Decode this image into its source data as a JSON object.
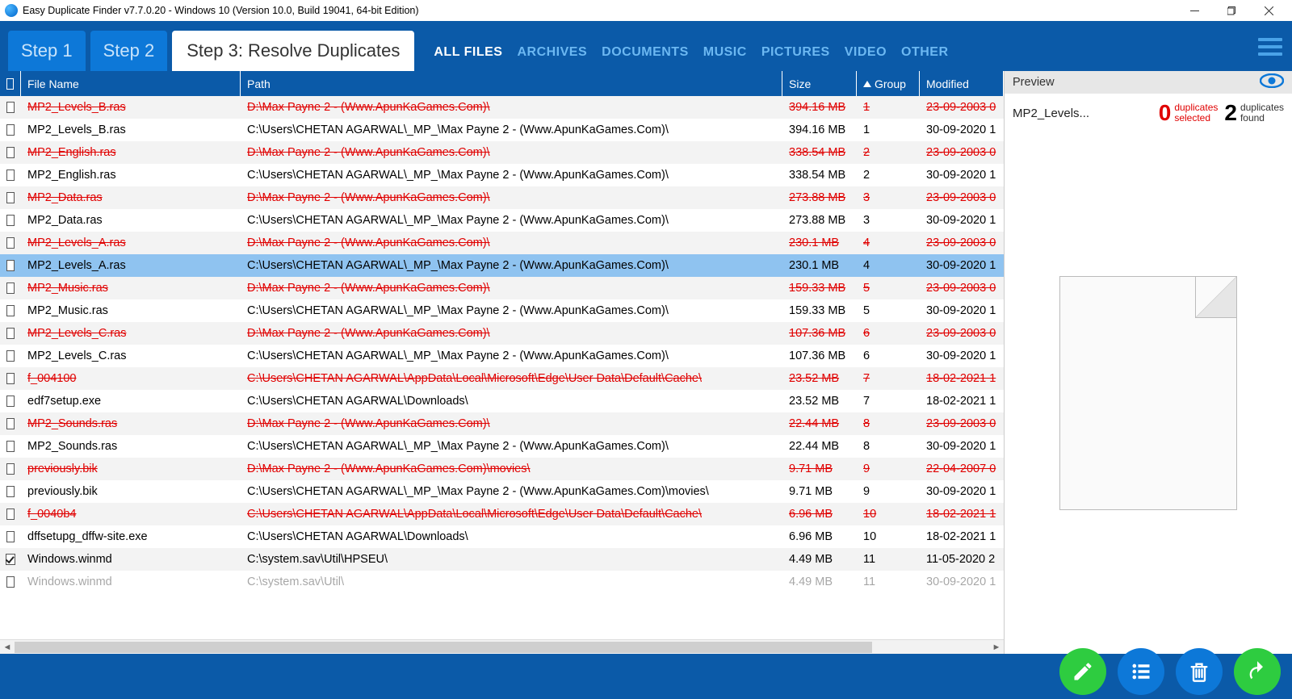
{
  "window": {
    "title": "Easy Duplicate Finder v7.7.0.20 - Windows 10 (Version 10.0, Build 19041, 64-bit Edition)"
  },
  "steps": {
    "step1": "Step 1",
    "step2": "Step 2",
    "step3": "Step 3: Resolve Duplicates"
  },
  "filters": {
    "all": "ALL FILES",
    "archives": "ARCHIVES",
    "documents": "DOCUMENTS",
    "music": "MUSIC",
    "pictures": "PICTURES",
    "video": "VIDEO",
    "other": "OTHER"
  },
  "columns": {
    "name": "File Name",
    "path": "Path",
    "size": "Size",
    "group": "Group",
    "modified": "Modified"
  },
  "rows": [
    {
      "struck": true,
      "name": "MP2_Levels_B.ras",
      "path": "D:\\Max Payne 2 - (Www.ApunKaGames.Com)\\",
      "size": "394.16 MB",
      "group": "1",
      "modified": "23-09-2003 0"
    },
    {
      "struck": false,
      "name": "MP2_Levels_B.ras",
      "path": "C:\\Users\\CHETAN AGARWAL\\_MP_\\Max Payne 2 - (Www.ApunKaGames.Com)\\",
      "size": "394.16 MB",
      "group": "1",
      "modified": "30-09-2020 1"
    },
    {
      "struck": true,
      "name": "MP2_English.ras",
      "path": "D:\\Max Payne 2 - (Www.ApunKaGames.Com)\\",
      "size": "338.54 MB",
      "group": "2",
      "modified": "23-09-2003 0"
    },
    {
      "struck": false,
      "name": "MP2_English.ras",
      "path": "C:\\Users\\CHETAN AGARWAL\\_MP_\\Max Payne 2 - (Www.ApunKaGames.Com)\\",
      "size": "338.54 MB",
      "group": "2",
      "modified": "30-09-2020 1"
    },
    {
      "struck": true,
      "name": "MP2_Data.ras",
      "path": "D:\\Max Payne 2 - (Www.ApunKaGames.Com)\\",
      "size": "273.88 MB",
      "group": "3",
      "modified": "23-09-2003 0"
    },
    {
      "struck": false,
      "name": "MP2_Data.ras",
      "path": "C:\\Users\\CHETAN AGARWAL\\_MP_\\Max Payne 2 - (Www.ApunKaGames.Com)\\",
      "size": "273.88 MB",
      "group": "3",
      "modified": "30-09-2020 1"
    },
    {
      "struck": true,
      "name": "MP2_Levels_A.ras",
      "path": "D:\\Max Payne 2 - (Www.ApunKaGames.Com)\\",
      "size": "230.1 MB",
      "group": "4",
      "modified": "23-09-2003 0"
    },
    {
      "struck": false,
      "selected": true,
      "name": "MP2_Levels_A.ras",
      "path": "C:\\Users\\CHETAN AGARWAL\\_MP_\\Max Payne 2 - (Www.ApunKaGames.Com)\\",
      "size": "230.1 MB",
      "group": "4",
      "modified": "30-09-2020 1"
    },
    {
      "struck": true,
      "name": "MP2_Music.ras",
      "path": "D:\\Max Payne 2 - (Www.ApunKaGames.Com)\\",
      "size": "159.33 MB",
      "group": "5",
      "modified": "23-09-2003 0"
    },
    {
      "struck": false,
      "name": "MP2_Music.ras",
      "path": "C:\\Users\\CHETAN AGARWAL\\_MP_\\Max Payne 2 - (Www.ApunKaGames.Com)\\",
      "size": "159.33 MB",
      "group": "5",
      "modified": "30-09-2020 1"
    },
    {
      "struck": true,
      "name": "MP2_Levels_C.ras",
      "path": "D:\\Max Payne 2 - (Www.ApunKaGames.Com)\\",
      "size": "107.36 MB",
      "group": "6",
      "modified": "23-09-2003 0"
    },
    {
      "struck": false,
      "name": "MP2_Levels_C.ras",
      "path": "C:\\Users\\CHETAN AGARWAL\\_MP_\\Max Payne 2 - (Www.ApunKaGames.Com)\\",
      "size": "107.36 MB",
      "group": "6",
      "modified": "30-09-2020 1"
    },
    {
      "struck": true,
      "name": "f_004100",
      "path": "C:\\Users\\CHETAN AGARWAL\\AppData\\Local\\Microsoft\\Edge\\User Data\\Default\\Cache\\",
      "size": "23.52 MB",
      "group": "7",
      "modified": "18-02-2021 1"
    },
    {
      "struck": false,
      "name": "edf7setup.exe",
      "path": "C:\\Users\\CHETAN AGARWAL\\Downloads\\",
      "size": "23.52 MB",
      "group": "7",
      "modified": "18-02-2021 1"
    },
    {
      "struck": true,
      "name": "MP2_Sounds.ras",
      "path": "D:\\Max Payne 2 - (Www.ApunKaGames.Com)\\",
      "size": "22.44 MB",
      "group": "8",
      "modified": "23-09-2003 0"
    },
    {
      "struck": false,
      "name": "MP2_Sounds.ras",
      "path": "C:\\Users\\CHETAN AGARWAL\\_MP_\\Max Payne 2 - (Www.ApunKaGames.Com)\\",
      "size": "22.44 MB",
      "group": "8",
      "modified": "30-09-2020 1"
    },
    {
      "struck": true,
      "name": "previously.bik",
      "path": "D:\\Max Payne 2 - (Www.ApunKaGames.Com)\\movies\\",
      "size": "9.71 MB",
      "group": "9",
      "modified": "22-04-2007 0"
    },
    {
      "struck": false,
      "name": "previously.bik",
      "path": "C:\\Users\\CHETAN AGARWAL\\_MP_\\Max Payne 2 - (Www.ApunKaGames.Com)\\movies\\",
      "size": "9.71 MB",
      "group": "9",
      "modified": "30-09-2020 1"
    },
    {
      "struck": true,
      "name": "f_0040b4",
      "path": "C:\\Users\\CHETAN AGARWAL\\AppData\\Local\\Microsoft\\Edge\\User Data\\Default\\Cache\\",
      "size": "6.96 MB",
      "group": "10",
      "modified": "18-02-2021 1"
    },
    {
      "struck": false,
      "name": "dffsetupg_dffw-site.exe",
      "path": "C:\\Users\\CHETAN AGARWAL\\Downloads\\",
      "size": "6.96 MB",
      "group": "10",
      "modified": "18-02-2021 1"
    },
    {
      "struck": false,
      "checked": true,
      "name": "Windows.winmd",
      "path": "C:\\system.sav\\Util\\HPSEU\\",
      "size": "4.49 MB",
      "group": "11",
      "modified": "11-05-2020 2"
    },
    {
      "struck": false,
      "partial": true,
      "name": "Windows.winmd",
      "path": "C:\\system.sav\\Util\\",
      "size": "4.49 MB",
      "group": "11",
      "modified": "30-09-2020 1"
    }
  ],
  "preview": {
    "header": "Preview",
    "file": "MP2_Levels...",
    "selected_count": "0",
    "selected_label": "duplicates\nselected",
    "found_count": "2",
    "found_label": "duplicates\nfound"
  }
}
